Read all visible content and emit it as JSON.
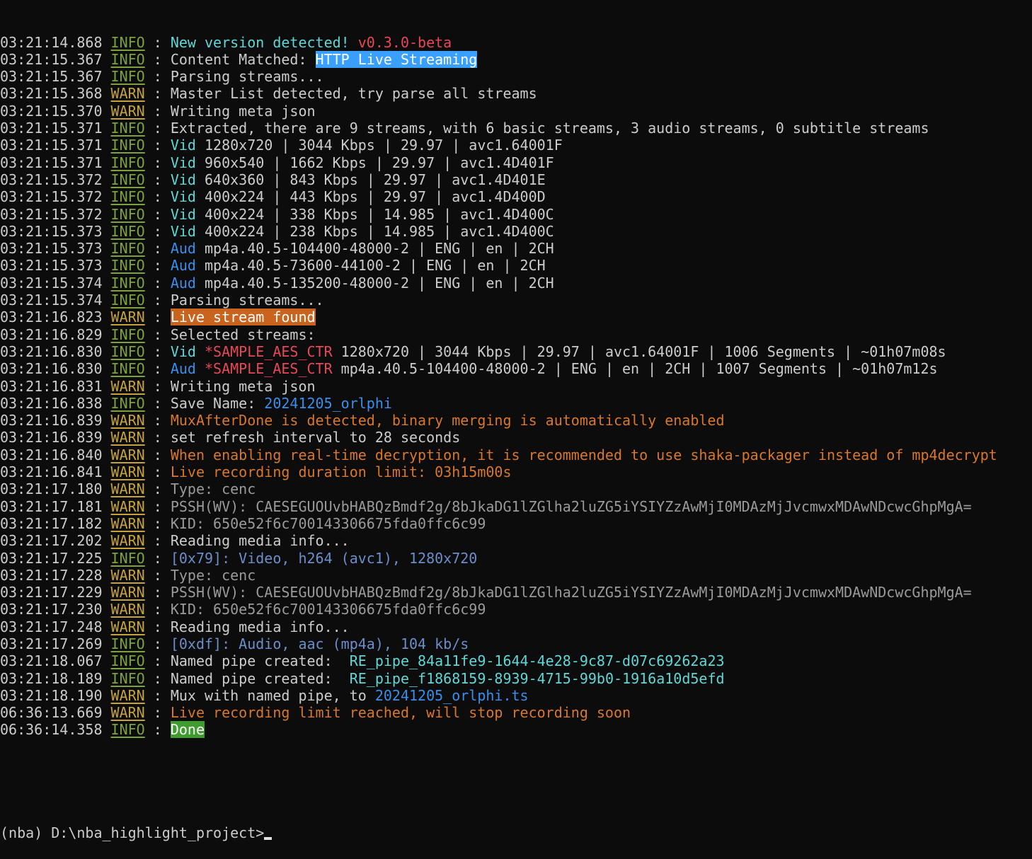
{
  "colors": {
    "background": "#0c0c0c",
    "text": "#cccccc",
    "info": "#7ea23b",
    "warn": "#c6a23a",
    "teal": "#61d6d6",
    "blue": "#3b8eea",
    "red": "#e74856",
    "orange": "#d9772b"
  },
  "separator": " : ",
  "lines": [
    {
      "time": "03:21:14.868",
      "level": "INFO",
      "segs": [
        {
          "t": "New version detected! ",
          "c": "c-teal"
        },
        {
          "t": "v0.3.0-beta",
          "c": "c-red"
        }
      ]
    },
    {
      "time": "03:21:15.367",
      "level": "INFO",
      "segs": [
        {
          "t": "Content Matched: ",
          "c": "c-default"
        },
        {
          "t": "HTTP Live Streaming",
          "c": "hl-blue"
        }
      ]
    },
    {
      "time": "03:21:15.367",
      "level": "INFO",
      "segs": [
        {
          "t": "Parsing streams...",
          "c": "c-default"
        }
      ]
    },
    {
      "time": "03:21:15.368",
      "level": "WARN",
      "segs": [
        {
          "t": "Master List detected, try parse all streams",
          "c": "c-default"
        }
      ]
    },
    {
      "time": "03:21:15.370",
      "level": "WARN",
      "segs": [
        {
          "t": "Writing meta json",
          "c": "c-default"
        }
      ]
    },
    {
      "time": "03:21:15.371",
      "level": "INFO",
      "segs": [
        {
          "t": "Extracted, there are 9 streams, with 6 basic streams, 3 audio streams, 0 subtitle streams",
          "c": "c-default"
        }
      ]
    },
    {
      "time": "03:21:15.371",
      "level": "INFO",
      "segs": [
        {
          "t": "Vid",
          "c": "c-teal"
        },
        {
          "t": " 1280x720 | 3044 Kbps | 29.97 | avc1.64001F",
          "c": "c-default"
        }
      ]
    },
    {
      "time": "03:21:15.371",
      "level": "INFO",
      "segs": [
        {
          "t": "Vid",
          "c": "c-teal"
        },
        {
          "t": " 960x540 | 1662 Kbps | 29.97 | avc1.4D401F",
          "c": "c-default"
        }
      ]
    },
    {
      "time": "03:21:15.372",
      "level": "INFO",
      "segs": [
        {
          "t": "Vid",
          "c": "c-teal"
        },
        {
          "t": " 640x360 | 843 Kbps | 29.97 | avc1.4D401E",
          "c": "c-default"
        }
      ]
    },
    {
      "time": "03:21:15.372",
      "level": "INFO",
      "segs": [
        {
          "t": "Vid",
          "c": "c-teal"
        },
        {
          "t": " 400x224 | 443 Kbps | 29.97 | avc1.4D400D",
          "c": "c-default"
        }
      ]
    },
    {
      "time": "03:21:15.372",
      "level": "INFO",
      "segs": [
        {
          "t": "Vid",
          "c": "c-teal"
        },
        {
          "t": " 400x224 | 338 Kbps | 14.985 | avc1.4D400C",
          "c": "c-default"
        }
      ]
    },
    {
      "time": "03:21:15.373",
      "level": "INFO",
      "segs": [
        {
          "t": "Vid",
          "c": "c-teal"
        },
        {
          "t": " 400x224 | 238 Kbps | 14.985 | avc1.4D400C",
          "c": "c-default"
        }
      ]
    },
    {
      "time": "03:21:15.373",
      "level": "INFO",
      "segs": [
        {
          "t": "Aud",
          "c": "c-blue"
        },
        {
          "t": " mp4a.40.5-104400-48000-2 | ENG | en | 2CH",
          "c": "c-default"
        }
      ]
    },
    {
      "time": "03:21:15.373",
      "level": "INFO",
      "segs": [
        {
          "t": "Aud",
          "c": "c-blue"
        },
        {
          "t": " mp4a.40.5-73600-44100-2 | ENG | en | 2CH",
          "c": "c-default"
        }
      ]
    },
    {
      "time": "03:21:15.374",
      "level": "INFO",
      "segs": [
        {
          "t": "Aud",
          "c": "c-blue"
        },
        {
          "t": " mp4a.40.5-135200-48000-2 | ENG | en | 2CH",
          "c": "c-default"
        }
      ]
    },
    {
      "time": "03:21:15.374",
      "level": "INFO",
      "segs": [
        {
          "t": "Parsing streams...",
          "c": "c-default"
        }
      ]
    },
    {
      "time": "03:21:16.823",
      "level": "WARN",
      "segs": [
        {
          "t": "Live stream found",
          "c": "hl-orange"
        }
      ]
    },
    {
      "time": "03:21:16.829",
      "level": "INFO",
      "segs": [
        {
          "t": "Selected streams:",
          "c": "c-default"
        }
      ]
    },
    {
      "time": "03:21:16.830",
      "level": "INFO",
      "segs": [
        {
          "t": "Vid",
          "c": "c-teal"
        },
        {
          "t": " *SAMPLE_AES_CTR",
          "c": "c-red"
        },
        {
          "t": " 1280x720 | 3044 Kbps | 29.97 | avc1.64001F | 1006 Segments | ~01h07m08s",
          "c": "c-default"
        }
      ]
    },
    {
      "time": "03:21:16.830",
      "level": "INFO",
      "segs": [
        {
          "t": "Aud",
          "c": "c-blue"
        },
        {
          "t": " *SAMPLE_AES_CTR",
          "c": "c-red"
        },
        {
          "t": " mp4a.40.5-104400-48000-2 | ENG | en | 2CH | 1007 Segments | ~01h07m12s",
          "c": "c-default"
        }
      ]
    },
    {
      "time": "03:21:16.831",
      "level": "WARN",
      "segs": [
        {
          "t": "Writing meta json",
          "c": "c-default"
        }
      ]
    },
    {
      "time": "03:21:16.838",
      "level": "INFO",
      "segs": [
        {
          "t": "Save Name: ",
          "c": "c-default"
        },
        {
          "t": "20241205_orlphi",
          "c": "c-blue"
        }
      ]
    },
    {
      "time": "03:21:16.839",
      "level": "WARN",
      "segs": [
        {
          "t": "MuxAfterDone is detected, binary merging is automatically enabled",
          "c": "c-orange"
        }
      ]
    },
    {
      "time": "03:21:16.839",
      "level": "WARN",
      "segs": [
        {
          "t": "set refresh interval to 28 seconds",
          "c": "c-default"
        }
      ]
    },
    {
      "time": "03:21:16.840",
      "level": "WARN",
      "segs": [
        {
          "t": "When enabling real-time decryption, it is recommended to use shaka-packager instead of mp4decrypt",
          "c": "c-orange"
        }
      ]
    },
    {
      "time": "03:21:16.841",
      "level": "WARN",
      "segs": [
        {
          "t": "Live recording duration limit: 03h15m00s",
          "c": "c-orange"
        }
      ]
    },
    {
      "time": "03:21:17.180",
      "level": "WARN",
      "segs": [
        {
          "t": "Type: cenc",
          "c": "c-gray"
        }
      ]
    },
    {
      "time": "03:21:17.181",
      "level": "WARN",
      "segs": [
        {
          "t": "PSSH(WV): CAESEGUOUvbHABQzBmdf2g/8bJkaDG1lZGlha2luZG5iYSIYZzAwMjI0MDAzMjJvcmwxMDAwNDcwcGhpMgA=",
          "c": "c-gray"
        }
      ]
    },
    {
      "time": "03:21:17.182",
      "level": "WARN",
      "segs": [
        {
          "t": "KID: 650e52f6c700143306675fda0ffc6c99",
          "c": "c-gray"
        }
      ]
    },
    {
      "time": "03:21:17.202",
      "level": "WARN",
      "segs": [
        {
          "t": "Reading media info...",
          "c": "c-default"
        }
      ]
    },
    {
      "time": "03:21:17.225",
      "level": "INFO",
      "segs": [
        {
          "t": "[0x79]: Video, h264 (avc1), 1280x720",
          "c": "c-steel"
        }
      ]
    },
    {
      "time": "03:21:17.228",
      "level": "WARN",
      "segs": [
        {
          "t": "Type: cenc",
          "c": "c-gray"
        }
      ]
    },
    {
      "time": "03:21:17.229",
      "level": "WARN",
      "segs": [
        {
          "t": "PSSH(WV): CAESEGUOUvbHABQzBmdf2g/8bJkaDG1lZGlha2luZG5iYSIYZzAwMjI0MDAzMjJvcmwxMDAwNDcwcGhpMgA=",
          "c": "c-gray"
        }
      ]
    },
    {
      "time": "03:21:17.230",
      "level": "WARN",
      "segs": [
        {
          "t": "KID: 650e52f6c700143306675fda0ffc6c99",
          "c": "c-gray"
        }
      ]
    },
    {
      "time": "03:21:17.248",
      "level": "WARN",
      "segs": [
        {
          "t": "Reading media info...",
          "c": "c-default"
        }
      ]
    },
    {
      "time": "03:21:17.269",
      "level": "INFO",
      "segs": [
        {
          "t": "[0xdf]: Audio, aac (mp4a), 104 kb/s",
          "c": "c-steel"
        }
      ]
    },
    {
      "time": "03:21:18.067",
      "level": "INFO",
      "segs": [
        {
          "t": "Named pipe created:  ",
          "c": "c-default"
        },
        {
          "t": "RE_pipe_84a11fe9-1644-4e28-9c87-d07c69262a23",
          "c": "c-teal"
        }
      ]
    },
    {
      "time": "03:21:18.189",
      "level": "INFO",
      "segs": [
        {
          "t": "Named pipe created:  ",
          "c": "c-default"
        },
        {
          "t": "RE_pipe_f1868159-8939-4715-99b0-1916a10d5efd",
          "c": "c-teal"
        }
      ]
    },
    {
      "time": "03:21:18.190",
      "level": "WARN",
      "segs": [
        {
          "t": "Mux with named pipe, to ",
          "c": "c-default"
        },
        {
          "t": "20241205_orlphi.ts",
          "c": "c-blue"
        }
      ]
    },
    {
      "time": "06:36:13.669",
      "level": "WARN",
      "segs": [
        {
          "t": "Live recording limit reached, will stop recording soon",
          "c": "c-orange"
        }
      ]
    },
    {
      "time": "06:36:14.358",
      "level": "INFO",
      "segs": [
        {
          "t": "Done",
          "c": "hl-green"
        }
      ]
    }
  ],
  "prompt": "(nba) D:\\nba_highlight_project>"
}
